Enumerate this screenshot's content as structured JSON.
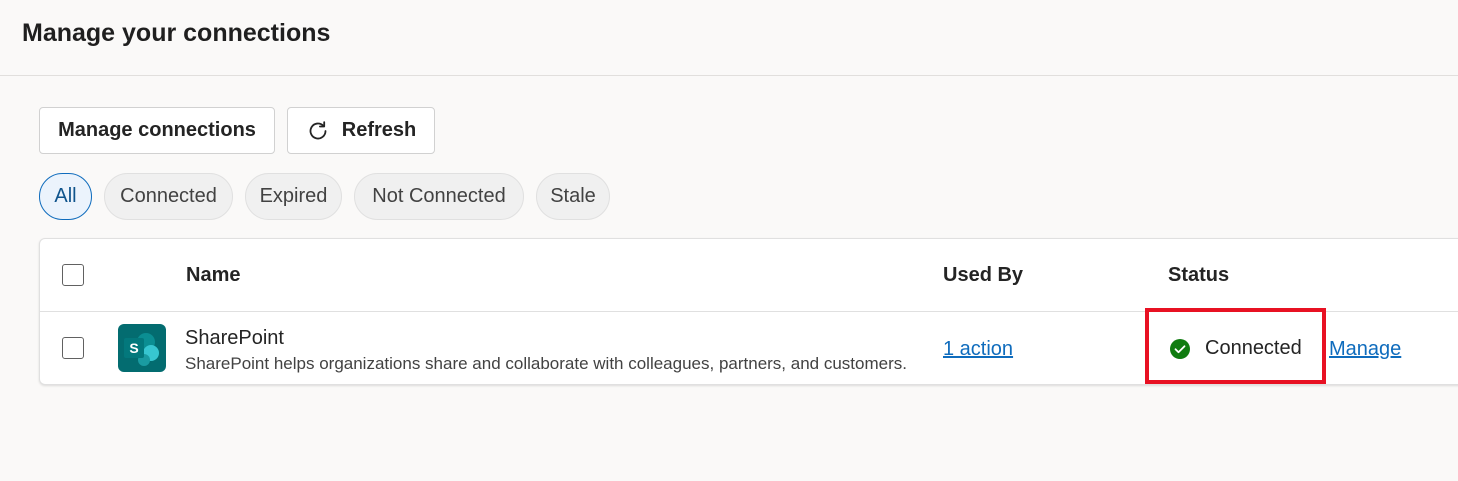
{
  "header": {
    "title": "Manage your connections"
  },
  "toolbar": {
    "manage_label": "Manage connections",
    "refresh_label": "Refresh",
    "refresh_icon": "refresh-icon"
  },
  "filters": [
    {
      "label": "All",
      "active": true
    },
    {
      "label": "Connected",
      "active": false
    },
    {
      "label": "Expired",
      "active": false
    },
    {
      "label": "Not Connected",
      "active": false
    },
    {
      "label": "Stale",
      "active": false
    }
  ],
  "table": {
    "columns": {
      "name": "Name",
      "used_by": "Used By",
      "status": "Status"
    },
    "rows": [
      {
        "icon": "sharepoint-icon",
        "icon_letter": "S",
        "name": "SharePoint",
        "description": "SharePoint helps organizations share and collaborate with colleagues, partners, and customers.",
        "used_by": "1 action",
        "status": "Connected",
        "status_icon": "check-circle-icon",
        "action": "Manage"
      }
    ]
  },
  "colors": {
    "accent": "#0f6cbd",
    "success": "#107c10",
    "highlight": "#e81123",
    "sharepoint": "#036c70"
  }
}
